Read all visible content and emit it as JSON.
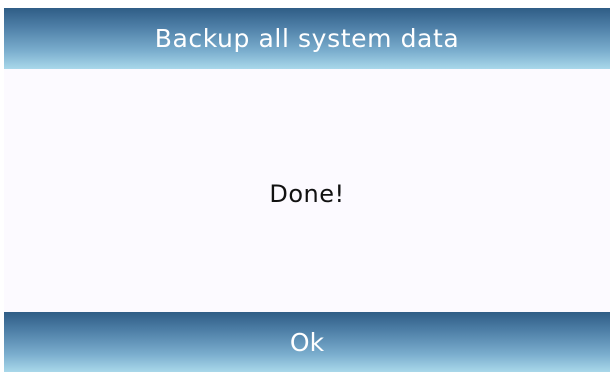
{
  "dialog": {
    "title": "Backup all system data",
    "message": "Done!",
    "ok_label": "Ok"
  },
  "colors": {
    "bar_dark": "#2f5d86",
    "bar_light": "#a9d8ea",
    "body_background": "#fcfaff",
    "text_dark": "#111111",
    "text_light": "#ffffff"
  }
}
